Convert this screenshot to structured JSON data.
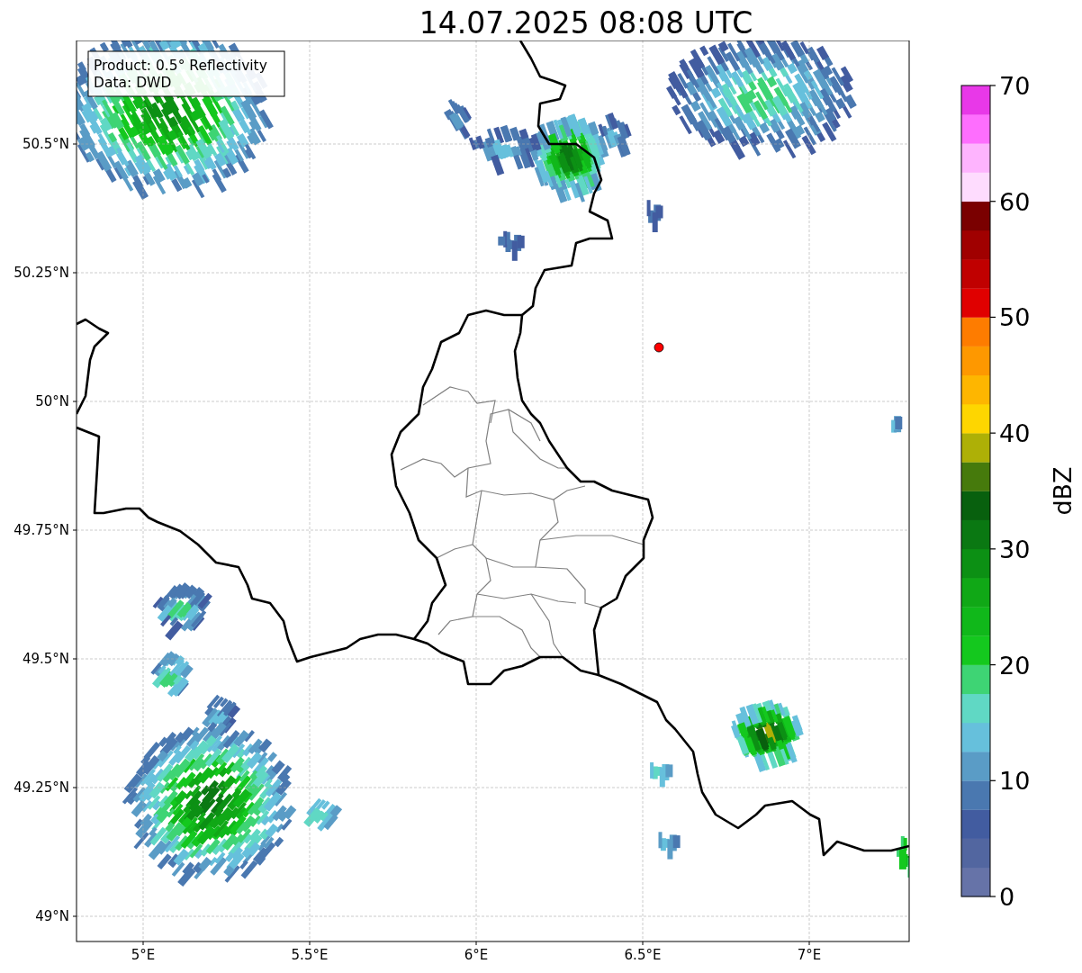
{
  "title": "14.07.2025 08:08 UTC",
  "info_box": [
    "Product: 0.5° Reflectivity",
    "Data: DWD"
  ],
  "map": {
    "x_ticks": [
      "5°E",
      "5.5°E",
      "6°E",
      "6.5°E",
      "7°E"
    ],
    "y_ticks": [
      "50.5°N",
      "50.25°N",
      "50°N",
      "49.75°N",
      "49.5°N",
      "49.25°N",
      "49°N"
    ]
  },
  "colorbar": {
    "label": "dBZ",
    "ticks": [
      "70",
      "60",
      "50",
      "40",
      "30",
      "20",
      "10",
      "0"
    ],
    "bands": [
      {
        "color": "#6673a8"
      },
      {
        "color": "#5266a0"
      },
      {
        "color": "#425ca0"
      },
      {
        "color": "#4a78b0"
      },
      {
        "color": "#5a9cc6"
      },
      {
        "color": "#66c0dc"
      },
      {
        "color": "#60d8c4"
      },
      {
        "color": "#3ed474"
      },
      {
        "color": "#14c81e"
      },
      {
        "color": "#10b81a"
      },
      {
        "color": "#10a816"
      },
      {
        "color": "#0c9014"
      },
      {
        "color": "#0a7812"
      },
      {
        "color": "#08600e"
      },
      {
        "color": "#467a0c"
      },
      {
        "color": "#aeb006"
      },
      {
        "color": "#fed600"
      },
      {
        "color": "#feb600"
      },
      {
        "color": "#fe9800"
      },
      {
        "color": "#fe7c00"
      },
      {
        "color": "#e00000"
      },
      {
        "color": "#c00000"
      },
      {
        "color": "#a00000"
      },
      {
        "color": "#7a0000"
      },
      {
        "color": "#fedcfe"
      },
      {
        "color": "#feb4fe"
      },
      {
        "color": "#fe6efe"
      },
      {
        "color": "#e838e8"
      }
    ]
  }
}
